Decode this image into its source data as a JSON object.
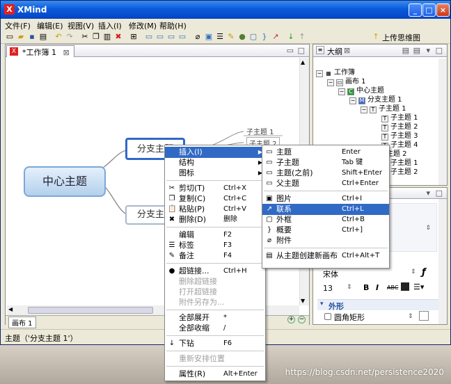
{
  "window": {
    "title": "XMind",
    "min": "_",
    "max": "□",
    "close": "×"
  },
  "menubar": [
    "文件(F)",
    "编辑(E)",
    "视图(V)",
    "插入(I)",
    "修改(M)",
    "帮助(H)"
  ],
  "toolbar": {
    "upload": "上传思维图"
  },
  "editor": {
    "tab_label": "*工作簿 1",
    "sheet_tab": "画布 1"
  },
  "mindmap": {
    "central": "中心主题",
    "branch1": "分支主题",
    "branch2": "分支主题",
    "subs": [
      "子主题 1",
      "子主题 2"
    ]
  },
  "outline": {
    "title": "大纲",
    "items": [
      "工作簿",
      "画布 1",
      "中心主题",
      "分支主题 1",
      "子主题 1",
      "子主题 1",
      "子主题 2",
      "子主题 3",
      "子主题 4",
      "子主题 2",
      "子主题 1",
      "子主题 2"
    ]
  },
  "props": {
    "font": "宋体",
    "size": "13",
    "section": "外形",
    "shape": "圆角矩形"
  },
  "status": "主题（'分支主题 1'）",
  "watermark": "https://blog.csdn.net/persistence2020",
  "context_menu": [
    {
      "label": "插入(I)",
      "shortcut": "",
      "submenu": true,
      "highlight": true
    },
    {
      "label": "结构",
      "shortcut": "",
      "submenu": true
    },
    {
      "label": "图标",
      "shortcut": "",
      "submenu": true
    },
    {
      "label": "剪切(T)",
      "shortcut": "Ctrl+X",
      "icon": "✂"
    },
    {
      "label": "复制(C)",
      "shortcut": "Ctrl+C",
      "icon": "❐"
    },
    {
      "label": "粘贴(P)",
      "shortcut": "Ctrl+V",
      "icon": "📋"
    },
    {
      "label": "删除(D)",
      "shortcut": "删除",
      "icon": "✖"
    },
    {
      "label": "编辑",
      "shortcut": "F2"
    },
    {
      "label": "标签",
      "shortcut": "F3",
      "icon": "☰"
    },
    {
      "label": "备注",
      "shortcut": "F4",
      "icon": "✎"
    },
    {
      "label": "超链接...",
      "shortcut": "Ctrl+H",
      "icon": "●"
    },
    {
      "label": "删除超链接",
      "shortcut": "",
      "disabled": true
    },
    {
      "label": "打开超链接",
      "shortcut": "",
      "disabled": true
    },
    {
      "label": "附件另存为...",
      "shortcut": "",
      "disabled": true
    },
    {
      "label": "全部展开",
      "shortcut": "*"
    },
    {
      "label": "全部收缩",
      "shortcut": "/"
    },
    {
      "label": "下钻",
      "shortcut": "F6",
      "icon": "↓"
    },
    {
      "label": "重新安排位置",
      "shortcut": "",
      "disabled": true
    },
    {
      "label": "属性(R)",
      "shortcut": "Alt+Enter"
    }
  ],
  "submenu": [
    {
      "label": "主题",
      "shortcut": "Enter",
      "icon": "▭"
    },
    {
      "label": "子主题",
      "shortcut": "Tab 键",
      "icon": "▭"
    },
    {
      "label": "主题(之前)",
      "shortcut": "Shift+Enter",
      "icon": "▭"
    },
    {
      "label": "父主题",
      "shortcut": "Ctrl+Enter",
      "icon": "▭"
    },
    {
      "label": "图片",
      "shortcut": "Ctrl+I",
      "icon": "▣"
    },
    {
      "label": "联系",
      "shortcut": "Ctrl+L",
      "icon": "↗",
      "highlight": true
    },
    {
      "label": "外框",
      "shortcut": "Ctrl+B",
      "icon": "▢"
    },
    {
      "label": "概要",
      "shortcut": "Ctrl+]",
      "icon": "}"
    },
    {
      "label": "附件",
      "shortcut": "",
      "icon": "⌀"
    },
    {
      "label": "从主题创建新画布",
      "shortcut": "Ctrl+Alt+T",
      "icon": "▤"
    }
  ]
}
